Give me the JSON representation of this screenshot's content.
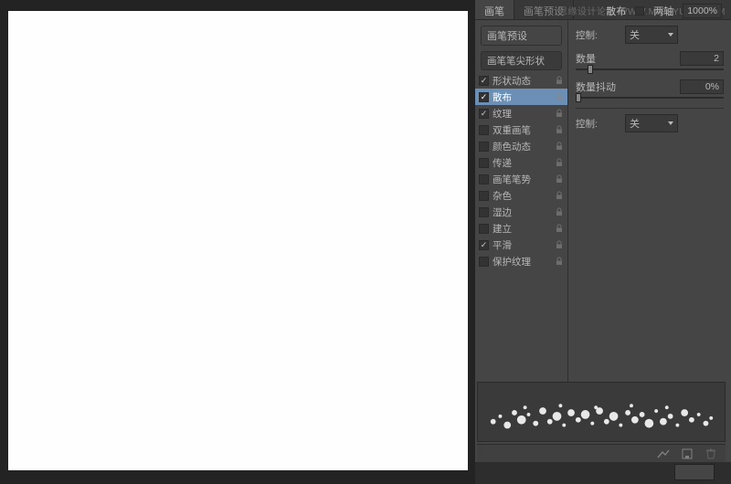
{
  "watermark": "思缘设计论坛  WWW.MISSYUAN.COM",
  "tabs": {
    "active": "画笔",
    "inactive": "画笔预设"
  },
  "leftPanel": {
    "presetBtn": "画笔预设",
    "groupLabel": "画笔笔尖形状",
    "items": [
      {
        "label": "形状动态",
        "checked": true,
        "selected": false,
        "locked": true
      },
      {
        "label": "散布",
        "checked": true,
        "selected": true,
        "locked": true
      },
      {
        "label": "纹理",
        "checked": true,
        "selected": false,
        "locked": true
      },
      {
        "label": "双重画笔",
        "checked": false,
        "selected": false,
        "locked": true
      },
      {
        "label": "颜色动态",
        "checked": false,
        "selected": false,
        "locked": true
      },
      {
        "label": "传递",
        "checked": false,
        "selected": false,
        "locked": true
      },
      {
        "label": "画笔笔势",
        "checked": false,
        "selected": false,
        "locked": true
      },
      {
        "label": "杂色",
        "checked": false,
        "selected": false,
        "locked": true
      },
      {
        "label": "湿边",
        "checked": false,
        "selected": false,
        "locked": true
      },
      {
        "label": "建立",
        "checked": false,
        "selected": false,
        "locked": true
      },
      {
        "label": "平滑",
        "checked": true,
        "selected": false,
        "locked": true
      },
      {
        "label": "保护纹理",
        "checked": false,
        "selected": false,
        "locked": true
      }
    ]
  },
  "topExtra": {
    "scatterLabel": "散布",
    "bothAxesLabel": "两轴",
    "bothAxesChecked": false,
    "percent": "1000%"
  },
  "right": {
    "control1": {
      "label": "控制:",
      "value": "关"
    },
    "count": {
      "label": "数量",
      "value": "2",
      "thumbPos": 8
    },
    "jitter": {
      "label": "数量抖动",
      "value": "0%",
      "thumbPos": 0
    },
    "control2": {
      "label": "控制:",
      "value": "关"
    }
  }
}
